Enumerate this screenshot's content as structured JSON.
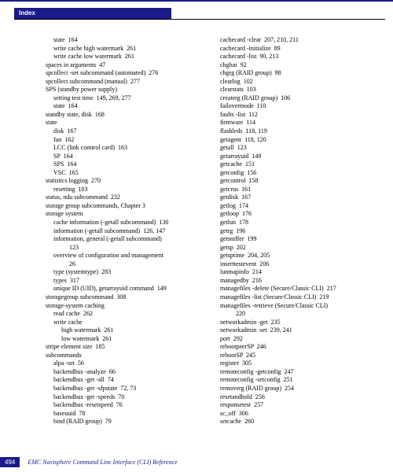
{
  "header": {
    "tab": "Index"
  },
  "footer": {
    "page": "494",
    "title": "EMC Navisphere Command Line Interface (CLI) Reference"
  },
  "col1": [
    {
      "t": "state  164",
      "i": 2
    },
    {
      "t": "write cache high watermark  261",
      "i": 2
    },
    {
      "t": "write cache low watermark  261",
      "i": 2
    },
    {
      "t": "spaces in arguments  47",
      "i": 1
    },
    {
      "t": "spcollect -set subcommand (automated)  276",
      "i": 1
    },
    {
      "t": "spcollect subcommand (manual)  277",
      "i": 1
    },
    {
      "t": "SPS (standby power supply)",
      "i": 1
    },
    {
      "t": "setting test time  149, 269, 277",
      "i": 2
    },
    {
      "t": "state  164",
      "i": 2
    },
    {
      "t": "standby state, disk  168",
      "i": 1
    },
    {
      "t": "state",
      "i": 1
    },
    {
      "t": "disk  167",
      "i": 2
    },
    {
      "t": "fan  162",
      "i": 2
    },
    {
      "t": "LCC (link comtrol card)  163",
      "i": 2
    },
    {
      "t": "SP  164",
      "i": 2
    },
    {
      "t": "SPS  164",
      "i": 2
    },
    {
      "t": "VSC  165",
      "i": 2
    },
    {
      "t": "statistics logging  270",
      "i": 1
    },
    {
      "t": "resetting  103",
      "i": 2
    },
    {
      "t": "status, ndu subcommand  232",
      "i": 1
    },
    {
      "t": "storage group subcommands, Chapter 3",
      "i": 1
    },
    {
      "t": "storage system",
      "i": 1
    },
    {
      "t": "cache information (-getall subcommand)  130",
      "i": 2
    },
    {
      "t": "information (-getall subcommand)  126, 147",
      "i": 2
    },
    {
      "t": "information, general (-getall subcommand)",
      "i": 2
    },
    {
      "t": "123",
      "i": 4
    },
    {
      "t": "overview of configuration and management",
      "i": 2
    },
    {
      "t": "26",
      "i": 4
    },
    {
      "t": "type (systemtype)  283",
      "i": 2
    },
    {
      "t": "types  317",
      "i": 2
    },
    {
      "t": "unique ID (UID), getarrayuid command  149",
      "i": 2
    },
    {
      "t": "storagegroup subcommand  308",
      "i": 1
    },
    {
      "t": "storage-system caching",
      "i": 1
    },
    {
      "t": "read cache  262",
      "i": 2
    },
    {
      "t": "write cache",
      "i": 2
    },
    {
      "t": "high watermark  261",
      "i": 3
    },
    {
      "t": "low watermark  261",
      "i": 3
    },
    {
      "t": "stripe element size  185",
      "i": 1
    },
    {
      "t": "subcommands",
      "i": 1
    },
    {
      "t": "alpa -set  56",
      "i": 2
    },
    {
      "t": "backendbus -analyze  66",
      "i": 2
    },
    {
      "t": "backendbus -get -all  74",
      "i": 2
    },
    {
      "t": "backendbus -get -sfpstate  72, 73",
      "i": 2
    },
    {
      "t": "backendbus -get -speeds  70",
      "i": 2
    },
    {
      "t": "backendbus -resetspeed  76",
      "i": 2
    },
    {
      "t": "baseuuid  78",
      "i": 2
    },
    {
      "t": "bind (RAID group)  79",
      "i": 2
    }
  ],
  "col2": [
    {
      "t": "cachecard -clear  207, 210, 211",
      "i": 0
    },
    {
      "t": "cachecard -initialize  89",
      "i": 0
    },
    {
      "t": "cachecard -list  90, 213",
      "i": 0
    },
    {
      "t": "chglun  92",
      "i": 0
    },
    {
      "t": "chgrg (RAID group)  98",
      "i": 0
    },
    {
      "t": "clearlog  102",
      "i": 0
    },
    {
      "t": "clearstats  103",
      "i": 0
    },
    {
      "t": "createrg (RAID group)  106",
      "i": 0
    },
    {
      "t": "failovermode  110",
      "i": 0
    },
    {
      "t": "faults -list  112",
      "i": 0
    },
    {
      "t": "firmware  114",
      "i": 0
    },
    {
      "t": "flashleds  118, 119",
      "i": 0
    },
    {
      "t": "getagent  118, 120",
      "i": 0
    },
    {
      "t": "getall  123",
      "i": 0
    },
    {
      "t": "getarrayuid  149",
      "i": 0
    },
    {
      "t": "getcache  151",
      "i": 0
    },
    {
      "t": "getconfig  156",
      "i": 0
    },
    {
      "t": "getcontrol  158",
      "i": 0
    },
    {
      "t": "getcrus  161",
      "i": 0
    },
    {
      "t": "getdisk  167",
      "i": 0
    },
    {
      "t": "getlog  174",
      "i": 0
    },
    {
      "t": "getloop  176",
      "i": 0
    },
    {
      "t": "getlun  178",
      "i": 0
    },
    {
      "t": "getrg  196",
      "i": 0
    },
    {
      "t": "getsniffer  199",
      "i": 0
    },
    {
      "t": "getsp  202",
      "i": 0
    },
    {
      "t": "getsptime  204, 205",
      "i": 0
    },
    {
      "t": "inserttestevent  206",
      "i": 0
    },
    {
      "t": "lunmapinfo  214",
      "i": 0
    },
    {
      "t": "managedby  216",
      "i": 0
    },
    {
      "t": "managefiles -delete (Secure/Classic CLI)  217",
      "i": 0
    },
    {
      "t": "managefiles -list (Secure/Classic CLI)  219",
      "i": 0
    },
    {
      "t": "managefiles -retrieve (Secure/Classic CLI)",
      "i": 0
    },
    {
      "t": "220",
      "i": 2
    },
    {
      "t": "networkadmin -get  235",
      "i": 0
    },
    {
      "t": "networkadmin -set  239, 241",
      "i": 0
    },
    {
      "t": "port  292",
      "i": 0
    },
    {
      "t": "rebootpeerSP  246",
      "i": 0
    },
    {
      "t": "rebootSP  245",
      "i": 0
    },
    {
      "t": "register  305",
      "i": 0
    },
    {
      "t": "remoteconfig -getconfig  247",
      "i": 0
    },
    {
      "t": "remoteconfig -setconfig  251",
      "i": 0
    },
    {
      "t": "removerg (RAID group)  254",
      "i": 0
    },
    {
      "t": "resetandhold  256",
      "i": 0
    },
    {
      "t": "responsetest  257",
      "i": 0
    },
    {
      "t": "sc_off  306",
      "i": 0
    },
    {
      "t": "setcache  260",
      "i": 0
    }
  ]
}
